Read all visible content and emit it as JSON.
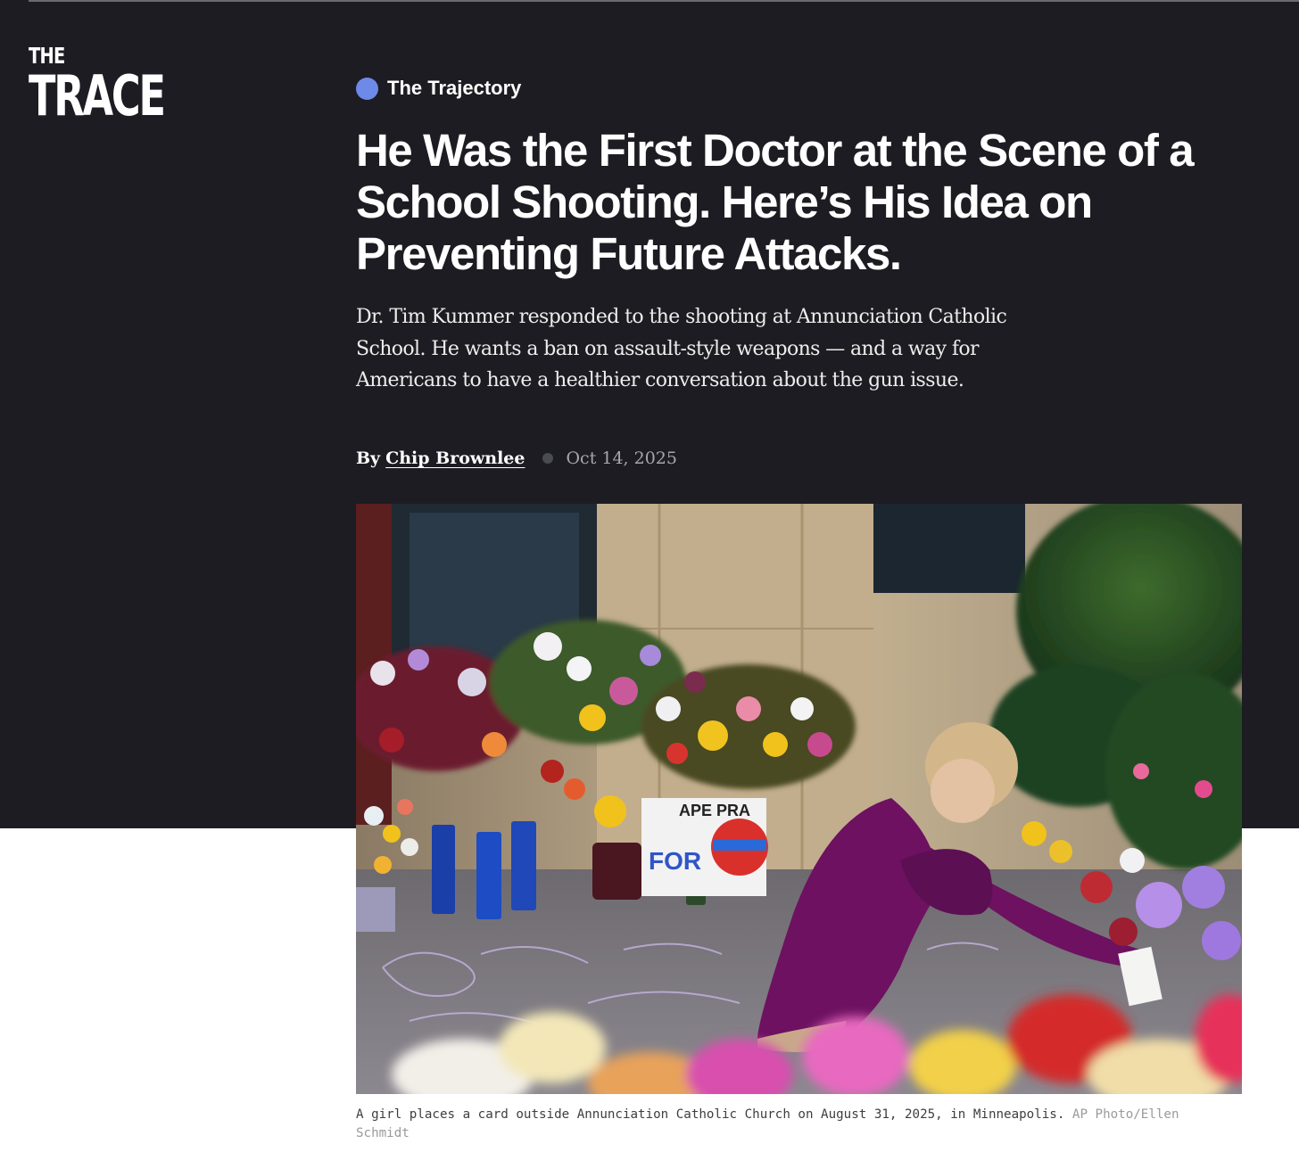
{
  "brand": {
    "logo_line1": "THE",
    "logo_line2": "TRACE"
  },
  "article": {
    "series": "The Trajectory",
    "headline": "He Was the First Doctor at the Scene of a School Shooting. Here’s His Idea on Preventing Future Attacks.",
    "dek": "Dr. Tim Kummer responded to the shooting at Annunciation Catholic School. He wants a ban on assault-style weapons — and a way for Americans to have a healthier conversation about the gun issue.",
    "byline_prefix": "By",
    "author": "Chip Brownlee",
    "date": "Oct 14, 2025"
  },
  "photo": {
    "chalk_text": "FOR",
    "sign_text": "APE PRA",
    "caption": "A girl places a card outside Annunciation Catholic Church on August 31, 2025, in Minneapolis.",
    "credit": "AP Photo/Ellen Schmidt"
  },
  "colors": {
    "hero_background": "#1c1c22",
    "series_dot": "#6e8ae8"
  }
}
